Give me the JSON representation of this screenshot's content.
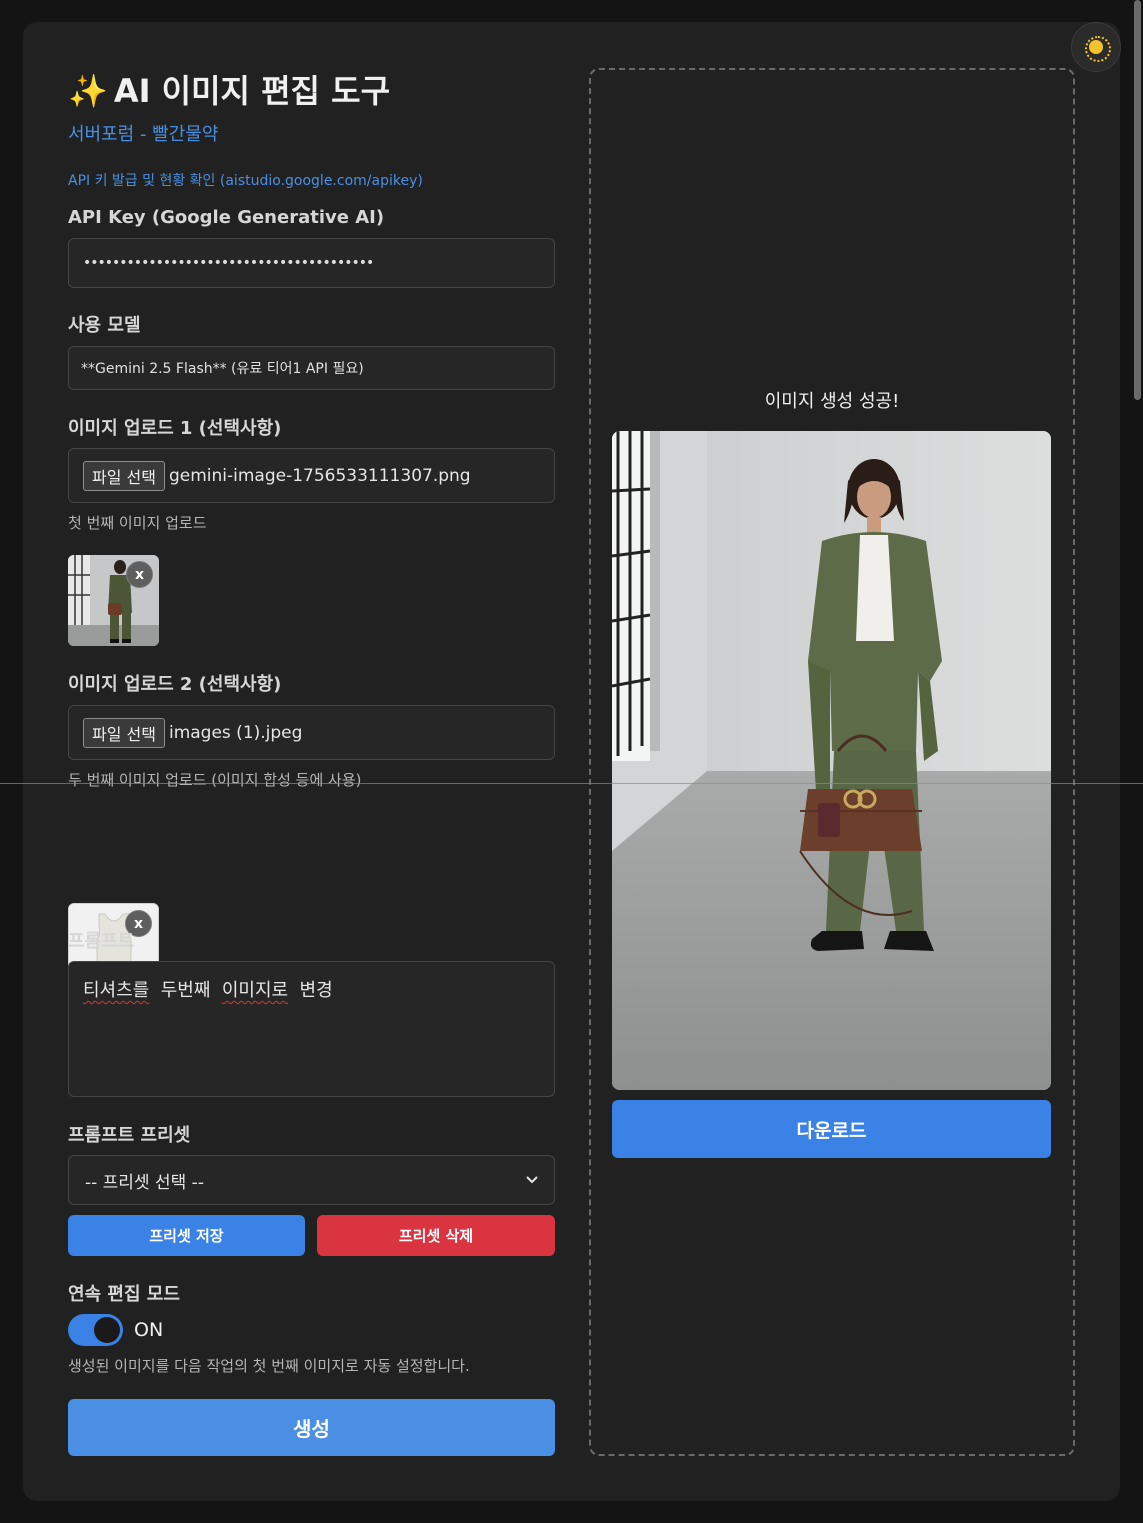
{
  "app": {
    "title": "AI 이미지 편집 도구",
    "title_emoji": "✨",
    "subtitle": "서버포럼 - 빨간물약",
    "api_link": "API 키 발급 및 현황 확인 (aistudio.google.com/apikey)"
  },
  "api_key": {
    "label": "API Key (Google Generative AI)",
    "value": "••••••••••••••••••••••••••••••••••••••••"
  },
  "model": {
    "label": "사용 모델",
    "value": "**Gemini 2.5 Flash** (유료 티어1 API 필요)"
  },
  "upload1": {
    "label": "이미지 업로드 1 (선택사항)",
    "button": "파일 선택",
    "filename": "gemini-image-1756533111307.png",
    "hint": "첫 번째 이미지 업로드",
    "remove": "x"
  },
  "upload2": {
    "label": "이미지 업로드 2 (선택사항)",
    "button": "파일 선택",
    "filename": "images (1).jpeg",
    "hint": "두 번째 이미지 업로드 (이미지 합성 등에 사용)",
    "remove": "x"
  },
  "prompt": {
    "label": "프롬프트",
    "words": [
      "티셔츠를",
      "두번째",
      "이미지로",
      "변경"
    ]
  },
  "preset": {
    "label": "프롬프트 프리셋",
    "selected": "-- 프리셋 선택 --",
    "save": "프리셋 저장",
    "delete": "프리셋 삭제"
  },
  "continuous": {
    "label": "연속 편집 모드",
    "state": "ON",
    "enabled": true,
    "description": "생성된 이미지를 다음 작업의 첫 번째 이미지로 자동 설정합니다."
  },
  "generate": {
    "label": "생성"
  },
  "result": {
    "status": "이미지 생성 성공!",
    "download": "다운로드"
  },
  "colors": {
    "accent": "#3b82e6",
    "danger": "#d9343f",
    "link": "#4a90e2",
    "background": "#212121"
  },
  "icons": {
    "theme_toggle": "sun-icon"
  }
}
